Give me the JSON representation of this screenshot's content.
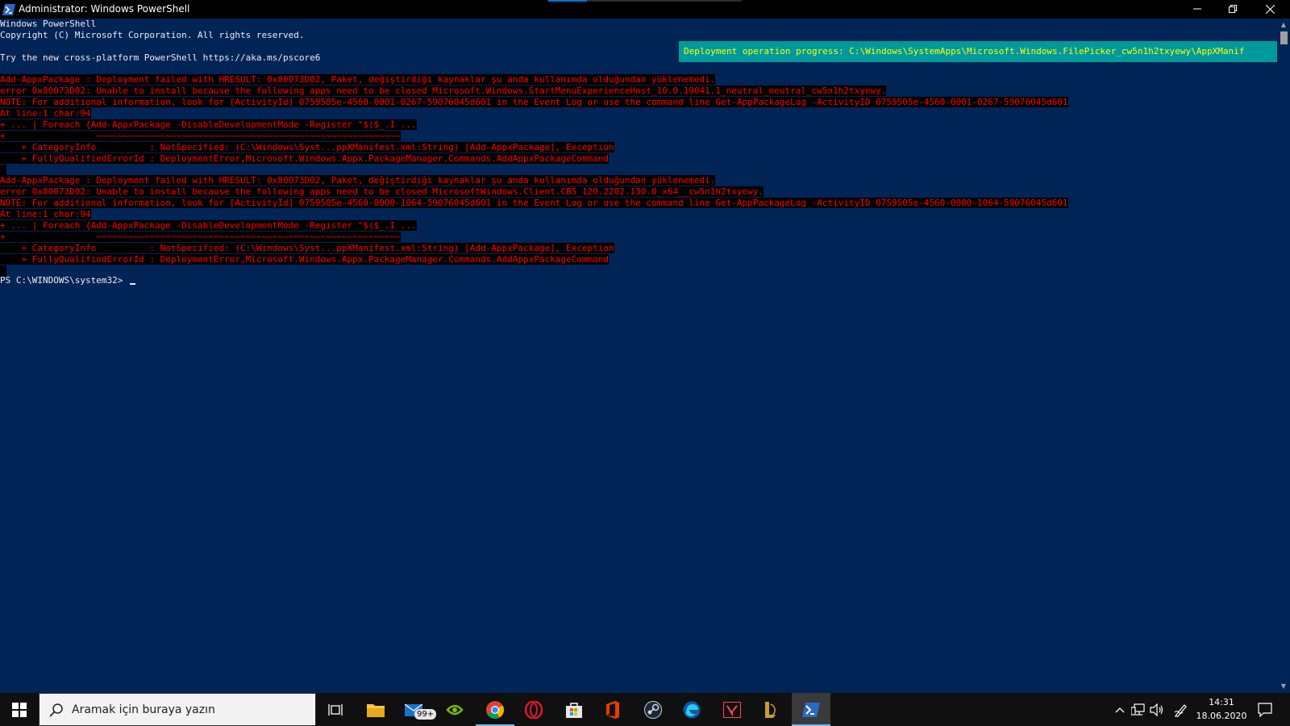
{
  "window": {
    "title": "Administrator: Windows PowerShell"
  },
  "console": {
    "intro": [
      "Windows PowerShell",
      "Copyright (C) Microsoft Corporation. All rights reserved.",
      "",
      "Try the new cross-platform PowerShell https://aka.ms/pscore6"
    ],
    "progress_text": "Deployment operation progress: C:\\Windows\\SystemApps\\Microsoft.Windows.FilePicker_cw5n1h2txyewy\\AppXManif",
    "error_block_1": [
      "Add-AppxPackage : Deployment failed with HRESULT: 0x80073D02, Paket, değiştirdiği kaynaklar şu anda kullanımda olduğundan yüklenemedi.",
      "error 0x80073D02: Unable to install because the following apps need to be closed Microsoft.Windows.StartMenuExperienceHost_10.0.19041.1_neutral_neutral_cw5n1h2txyewy.",
      "NOTE: For additional information, look for [ActivityId] 0759505e-4560-0001-0267-59076045d601 in the Event Log or use the command line Get-AppPackageLog -ActivityID 0759505e-4560-0001-0267-59076045d601",
      "At line:1 char:94",
      "+ ... | Foreach {Add-AppxPackage -DisableDevelopmentMode -Register \"$($_.I ...",
      "+                 ~~~~~~~~~~~~~~~~~~~~~~~~~~~~~~~~~~~~~~~~~~~~~~~~~~~~~~~~~",
      "    + CategoryInfo          : NotSpecified: (C:\\Windows\\Syst...ppXManifest.xml:String) [Add-AppxPackage], Exception",
      "    + FullyQualifiedErrorId : DeploymentError,Microsoft.Windows.Appx.PackageManager.Commands.AddAppxPackageCommand"
    ],
    "error_block_2": [
      "Add-AppxPackage : Deployment failed with HRESULT: 0x80073D02, Paket, değiştirdiği kaynaklar şu anda kullanımda olduğundan yüklenemedi.",
      "error 0x80073D02: Unable to install because the following apps need to be closed MicrosoftWindows.Client.CBS_120.2202.130.0_x64__cw5n1h2txyewy.",
      "NOTE: For additional information, look for [ActivityId] 0759505e-4560-0000-1064-59076045d601 in the Event Log or use the command line Get-AppPackageLog -ActivityID 0759505e-4560-0000-1064-59076045d601",
      "At line:1 char:94",
      "+ ... | Foreach {Add-AppxPackage -DisableDevelopmentMode -Register \"$($_.I ...",
      "+                 ~~~~~~~~~~~~~~~~~~~~~~~~~~~~~~~~~~~~~~~~~~~~~~~~~~~~~~~~~",
      "    + CategoryInfo          : NotSpecified: (C:\\Windows\\Syst...ppXManifest.xml:String) [Add-AppxPackage], Exception",
      "    + FullyQualifiedErrorId : DeploymentError,Microsoft.Windows.Appx.PackageManager.Commands.AddAppxPackageCommand"
    ],
    "prompt": "PS C:\\WINDOWS\\system32> "
  },
  "taskbar": {
    "search_placeholder": "Aramak için buraya yazın",
    "mail_badge": "99+",
    "clock_time": "14:31",
    "clock_date": "18.06.2020"
  },
  "colors": {
    "console_bg": "#012456",
    "error_fg": "#ff0000",
    "progress_bg": "#009a9c",
    "progress_fg": "#ffff00",
    "taskbar_bg": "#101010",
    "accent": "#0078d7"
  }
}
